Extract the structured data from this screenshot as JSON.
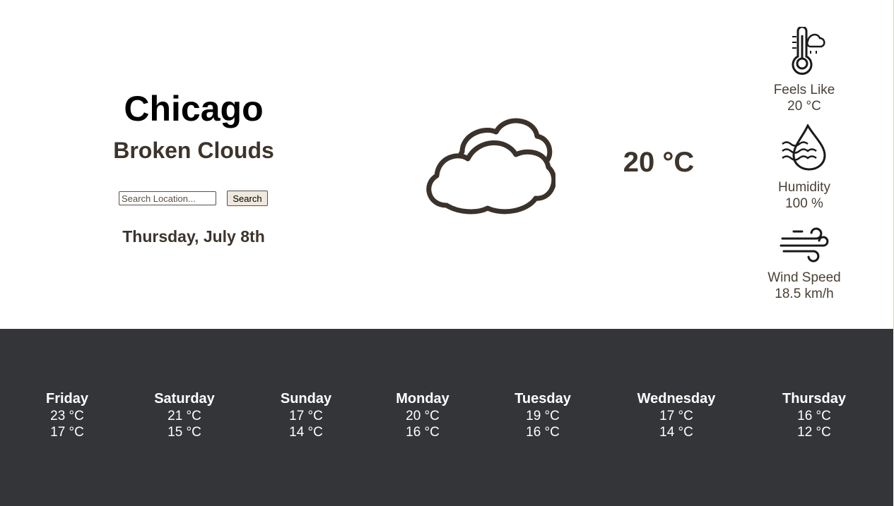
{
  "location": {
    "city": "Chicago",
    "condition": "Broken Clouds",
    "date": "Thursday, July 8th"
  },
  "search": {
    "placeholder": "Search Location...",
    "value": "",
    "button_label": "Search"
  },
  "current": {
    "temperature": "20 °C",
    "icon": "broken-clouds-icon"
  },
  "stats": {
    "feels_like": {
      "label": "Feels Like",
      "value": "20 °C",
      "icon": "thermometer-cloud-icon"
    },
    "humidity": {
      "label": "Humidity",
      "value": "100 %",
      "icon": "water-drop-icon"
    },
    "wind_speed": {
      "label": "Wind Speed",
      "value": "18.5 km/h",
      "icon": "wind-icon"
    }
  },
  "forecast": [
    {
      "day": "Friday",
      "high": "23 °C",
      "low": "17 °C"
    },
    {
      "day": "Saturday",
      "high": "21 °C",
      "low": "15 °C"
    },
    {
      "day": "Sunday",
      "high": "17 °C",
      "low": "14 °C"
    },
    {
      "day": "Monday",
      "high": "20 °C",
      "low": "16 °C"
    },
    {
      "day": "Tuesday",
      "high": "19 °C",
      "low": "16 °C"
    },
    {
      "day": "Wednesday",
      "high": "17 °C",
      "low": "14 °C"
    },
    {
      "day": "Thursday",
      "high": "16 °C",
      "low": "12 °C"
    }
  ],
  "colors": {
    "text_dark": "#3d342c",
    "footer_bg": "#343538",
    "button_bg": "#efe8dc"
  }
}
